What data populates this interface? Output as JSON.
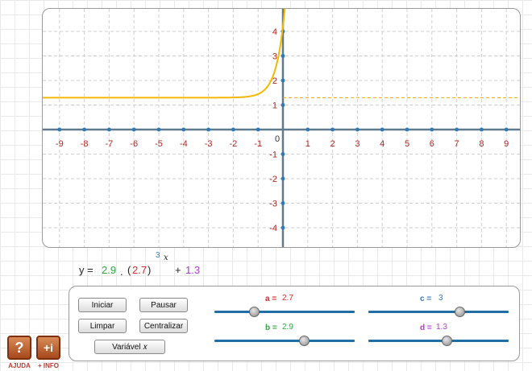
{
  "graph": {
    "x_ticks": [
      "-9",
      "-8",
      "-7",
      "-6",
      "-5",
      "-4",
      "-3",
      "-2",
      "-1",
      "1",
      "2",
      "3",
      "4",
      "5",
      "6",
      "7",
      "8",
      "9"
    ],
    "y_ticks": [
      "4",
      "3",
      "2",
      "1",
      "-1",
      "-2",
      "-3",
      "-4"
    ],
    "origin_label": "0",
    "left_edge_label": "0",
    "curve_color": "#f5b800",
    "asymptote_color": "#f0a800"
  },
  "formula": {
    "y_prefix": "y =",
    "b_value": "2.9",
    "dot": ".",
    "open_paren": "(",
    "a_value": "2.7",
    "close_paren": ")",
    "c_value": "3",
    "x_var": "x",
    "plus": "+",
    "d_value": "1.3"
  },
  "controls": {
    "iniciar": "Iniciar",
    "pausar": "Pausar",
    "limpar": "Limpar",
    "centralizar": "Centralizar",
    "variavel": "Variável 𝑥"
  },
  "params": {
    "a": {
      "label": "a =",
      "value": "2.7",
      "color": "#d22a2a",
      "slider_level": 0.28
    },
    "b": {
      "label": "b =",
      "value": "2.9",
      "color": "#2ca83d",
      "slider_level": 0.64
    },
    "c": {
      "label": "c =",
      "value": "3",
      "color": "#3a78c4",
      "slider_level": 0.65
    },
    "d": {
      "label": "d =",
      "value": "1.3",
      "color": "#b43ad8",
      "slider_level": 0.56
    }
  },
  "corner": {
    "help_glyph": "?",
    "help_caption": "AJUDA",
    "info_glyph": "+i",
    "info_caption": "+ INFO"
  }
}
